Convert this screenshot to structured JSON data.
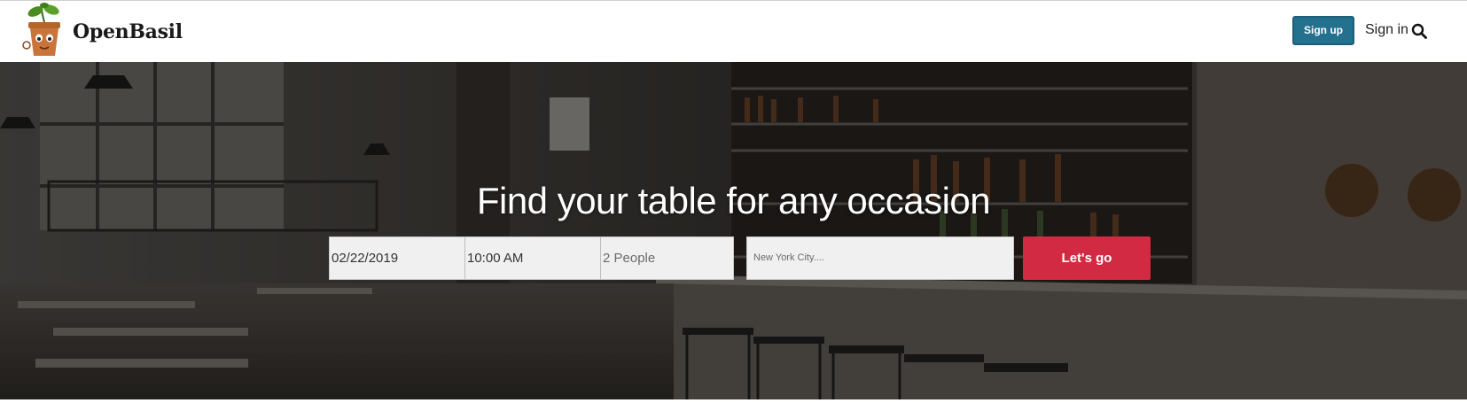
{
  "header": {
    "brand_name": "OpenBasil",
    "signup_label": "Sign up",
    "signin_label": "Sign in",
    "search_icon": "search-icon",
    "logo_icon": "potted-basil-mascot-logo"
  },
  "hero": {
    "title": "Find your table for any occasion",
    "background": "restaurant-bar-interior-photo",
    "date_value": "02/22/2019",
    "time_value": "10:00 AM",
    "party_value": "2 People",
    "location_placeholder": "New York City....",
    "go_label": "Let's go"
  },
  "colors": {
    "signup_bg": "#23708f",
    "go_bg": "#d22a43",
    "field_bg": "#f0f0f0",
    "hero_text": "#ffffff"
  }
}
